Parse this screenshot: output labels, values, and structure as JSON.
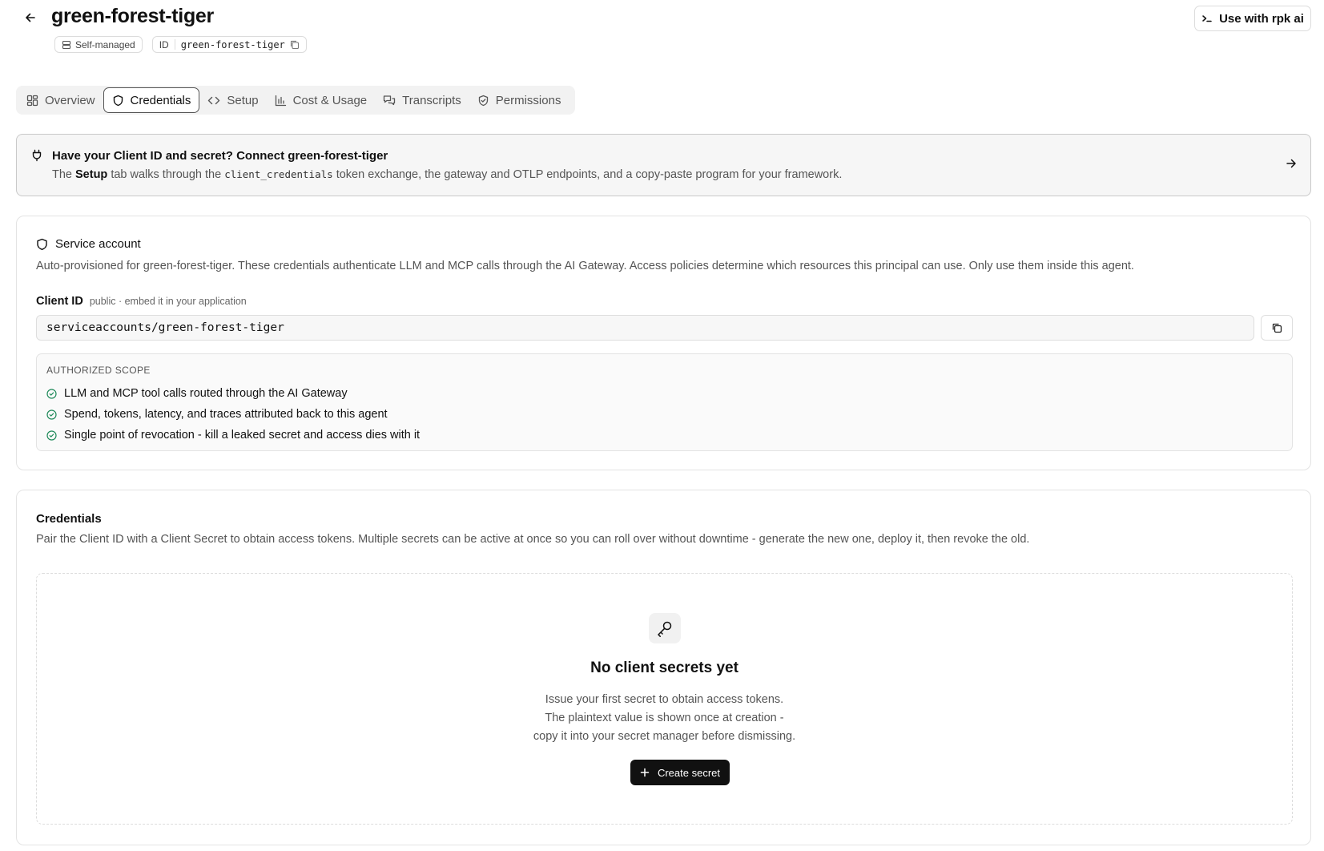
{
  "header": {
    "title": "green-forest-tiger",
    "badges": {
      "managed": "Self-managed",
      "id_label": "ID",
      "id_value": "green-forest-tiger"
    },
    "rpk_button": "Use with rpk ai"
  },
  "tabs": [
    {
      "label": "Overview",
      "icon": "grid-icon"
    },
    {
      "label": "Credentials",
      "icon": "shield-icon",
      "active": true
    },
    {
      "label": "Setup",
      "icon": "code-icon"
    },
    {
      "label": "Cost & Usage",
      "icon": "bar-chart-icon"
    },
    {
      "label": "Transcripts",
      "icon": "chat-icon"
    },
    {
      "label": "Permissions",
      "icon": "shield-check-icon"
    }
  ],
  "banner": {
    "title": "Have your Client ID and secret? Connect green-forest-tiger",
    "desc_prefix": "The ",
    "desc_strong": "Setup",
    "desc_mid": " tab walks through the ",
    "desc_code": "client_credentials",
    "desc_suffix": " token exchange, the gateway and OTLP endpoints, and a copy-paste program for your framework."
  },
  "service_account": {
    "title": "Service account",
    "description": "Auto-provisioned for green-forest-tiger. These credentials authenticate LLM and MCP calls through the AI Gateway. Access policies determine which resources this principal can use. Only use them inside this agent.",
    "client_id_label": "Client ID",
    "client_id_hint": "public · embed it in your application",
    "client_id_value": "serviceaccounts/green-forest-tiger",
    "scope_title": "AUTHORIZED SCOPE",
    "scope_items": [
      "LLM and MCP tool calls routed through the AI Gateway",
      "Spend, tokens, latency, and traces attributed back to this agent",
      "Single point of revocation - kill a leaked secret and access dies with it"
    ]
  },
  "credentials": {
    "title": "Credentials",
    "description": "Pair the Client ID with a Client Secret to obtain access tokens. Multiple secrets can be active at once so you can roll over without downtime - generate the new one, deploy it, then revoke the old.",
    "empty_title": "No client secrets yet",
    "empty_lines": [
      "Issue your first secret to obtain access tokens.",
      "The plaintext value is shown once at creation -",
      "copy it into your secret manager before dismissing."
    ],
    "create_button": "Create secret"
  },
  "colors": {
    "accent_green": "#1f8a5a",
    "button_dark": "#111111"
  }
}
